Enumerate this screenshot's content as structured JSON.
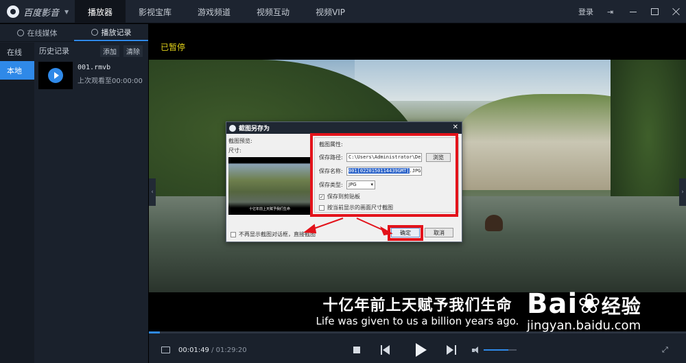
{
  "app": {
    "logo_text": "百度影音",
    "nav_tabs": [
      "播放器",
      "影视宝库",
      "游戏频道",
      "视频互动",
      "视频VIP"
    ],
    "login": "登录"
  },
  "sidebar": {
    "tabs": [
      "在线媒体",
      "播放记录"
    ],
    "left_items": [
      "在线",
      "本地"
    ],
    "history_title": "历史记录",
    "add_label": "添加",
    "clear_label": "清除",
    "history_items": [
      {
        "name": "001.rmvb",
        "last_watched": "上次观看至00:00:00"
      }
    ]
  },
  "player": {
    "status": "已暂停",
    "subtitle_zh": "十亿年前上天赋予我们生命",
    "subtitle_en": "Life was given to us a billion years ago.",
    "progress": 0.02,
    "volume": 0.75
  },
  "controls": {
    "current_time": "00:01:49",
    "total_time": "/ 01:29:20"
  },
  "dialog": {
    "title": "截图另存为",
    "preview_label": "截图预览:",
    "size_label": "尺寸:",
    "preview_subtitle": "十亿年前上天赋予我们生命",
    "group_title": "截图属性:",
    "path_label": "保存路径:",
    "path_value": "C:\\Users\\Administrator\\De",
    "browse_label": "浏览",
    "name_label": "保存名称:",
    "name_selected": "001[0220150114439GMT]",
    "name_ext": ".JPG",
    "type_label": "保存类型:",
    "type_value": "JPG",
    "save_clipboard_label": "保存到剪贴板",
    "save_clipboard_checked": true,
    "current_size_label": "按当前显示的画面尺寸截图",
    "no_dialog_label": "不再显示截图对话框，直接截图",
    "ok_label": "确定",
    "cancel_label": "取消"
  },
  "watermark": {
    "logo": "Bai",
    "logo_cn": "经验",
    "url": "jingyan.baidu.com"
  },
  "colors": {
    "accent": "#2f89e8",
    "annotation": "#e3131b",
    "paused_text": "#e2d21a"
  }
}
